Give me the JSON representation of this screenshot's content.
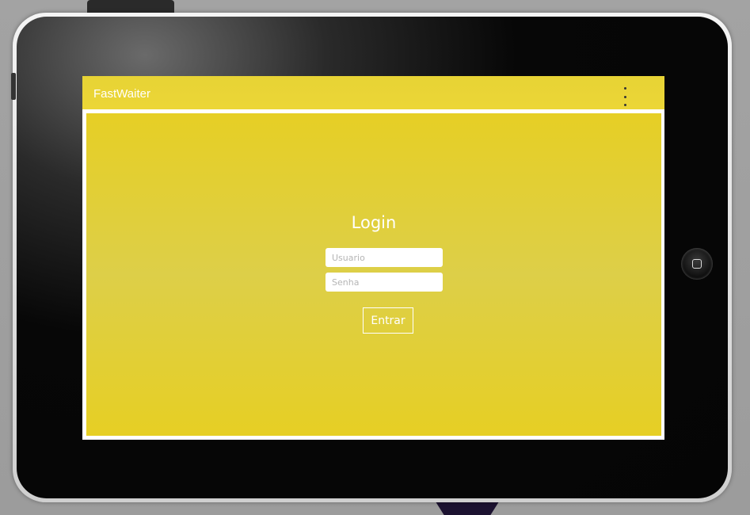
{
  "app": {
    "title": "FastWaiter",
    "menu_icon": "overflow-menu-icon",
    "accent_color": "#e6cf25"
  },
  "login": {
    "heading": "Login",
    "username": {
      "placeholder": "Usuario",
      "value": ""
    },
    "password": {
      "placeholder": "Senha",
      "value": ""
    },
    "submit_label": "Entrar"
  },
  "device": {
    "home_button_icon": "home-button-icon"
  }
}
